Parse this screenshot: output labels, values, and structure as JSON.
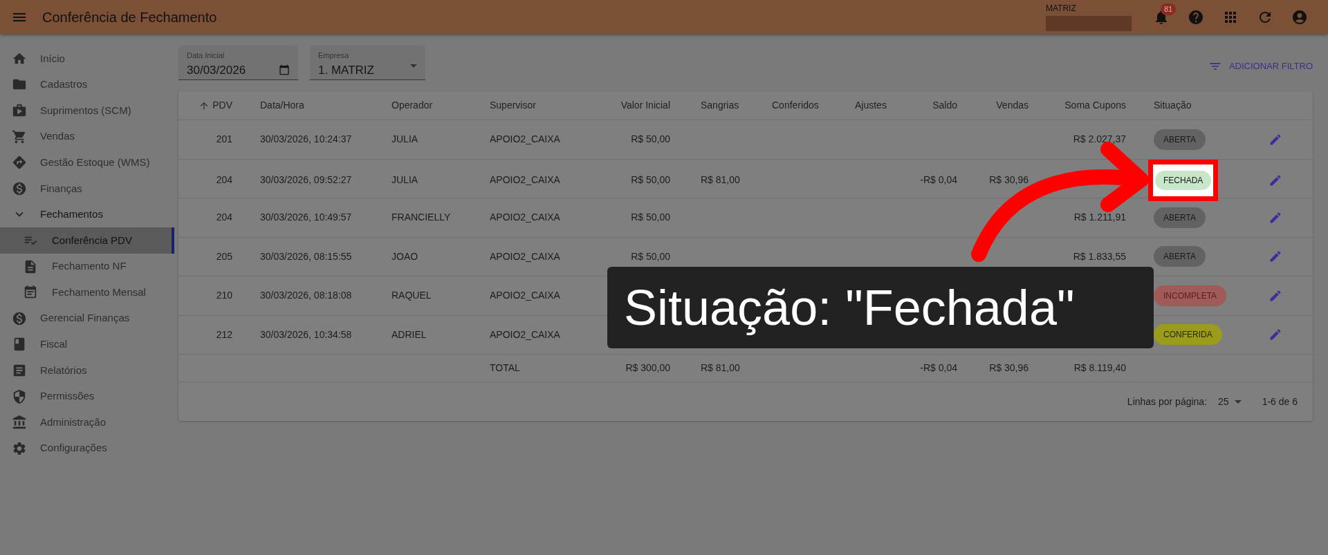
{
  "app_bar": {
    "title": "Conferência de Fechamento",
    "company": "MATRIZ",
    "notifications": "81"
  },
  "sidebar": {
    "items": [
      {
        "label": "Início",
        "selected": false
      },
      {
        "label": "Cadastros",
        "selected": false
      },
      {
        "label": "Suprimentos (SCM)",
        "selected": false
      },
      {
        "label": "Vendas",
        "selected": false
      },
      {
        "label": "Gestão Estoque (WMS)",
        "selected": false
      },
      {
        "label": "Finanças",
        "selected": false
      },
      {
        "label": "Fechamentos",
        "selected": false,
        "expanded": true,
        "children": [
          {
            "label": "Conferência PDV",
            "selected": true
          },
          {
            "label": "Fechamento NF",
            "selected": false
          },
          {
            "label": "Fechamento Mensal",
            "selected": false
          }
        ]
      },
      {
        "label": "Gerencial Finanças",
        "selected": false
      },
      {
        "label": "Fiscal",
        "selected": false
      },
      {
        "label": "Relatórios",
        "selected": false
      },
      {
        "label": "Permissões",
        "selected": false
      },
      {
        "label": "Administração",
        "selected": false
      },
      {
        "label": "Configurações",
        "selected": false
      }
    ]
  },
  "filters": {
    "date": {
      "label": "Data Inicial",
      "value": "30/03/2026"
    },
    "company": {
      "label": "Empresa",
      "value": "1. MATRIZ"
    },
    "add_filter": "ADICIONAR FILTRO"
  },
  "table": {
    "columns": [
      {
        "label": "PDV",
        "sorted": true
      },
      {
        "label": "Data/Hora",
        "sorted": false
      },
      {
        "label": "Operador",
        "sorted": false
      },
      {
        "label": "Supervisor",
        "sorted": false
      },
      {
        "label": "Valor Inicial",
        "sorted": false
      },
      {
        "label": "Sangrias",
        "sorted": false
      },
      {
        "label": "Conferidos",
        "sorted": false
      },
      {
        "label": "Ajustes",
        "sorted": false
      },
      {
        "label": "Saldo",
        "sorted": false
      },
      {
        "label": "Vendas",
        "sorted": false
      },
      {
        "label": "Soma Cupons",
        "sorted": false
      },
      {
        "label": "Situação",
        "sorted": false
      }
    ],
    "rows": [
      {
        "pdv": "201",
        "data_hora": "30/03/2026, 10:24:37",
        "operador": "JULIA",
        "supervisor": "APOIO2_CAIXA",
        "valor_inicial": "R$ 50,00",
        "soma_cupons": "R$ 2.027,37",
        "situacao": {
          "label": "ABERTA",
          "kind": "aberta"
        },
        "highlighted": false
      },
      {
        "pdv": "204",
        "data_hora": "30/03/2026, 09:52:27",
        "operador": "JULIA",
        "supervisor": "APOIO2_CAIXA",
        "valor_inicial": "R$ 50,00",
        "sangrias": "R$ 81,00",
        "saldo": "-R$ 0,04",
        "vendas": "R$ 30,96",
        "situacao": {
          "label": "FECHADA",
          "kind": "fechada"
        },
        "highlighted": true
      },
      {
        "pdv": "204",
        "data_hora": "30/03/2026, 10:49:57",
        "operador": "FRANCIELLY",
        "supervisor": "APOIO2_CAIXA",
        "valor_inicial": "R$ 50,00",
        "soma_cupons": "R$ 1.211,91",
        "situacao": {
          "label": "ABERTA",
          "kind": "aberta"
        },
        "highlighted": false
      },
      {
        "pdv": "205",
        "data_hora": "30/03/2026, 08:15:55",
        "operador": "JOAO",
        "supervisor": "APOIO2_CAIXA",
        "valor_inicial": "R$ 50,00",
        "soma_cupons": "R$ 1.833,55",
        "situacao": {
          "label": "ABERTA",
          "kind": "aberta"
        },
        "highlighted": false
      },
      {
        "pdv": "210",
        "data_hora": "30/03/2026, 08:18:08",
        "operador": "RAQUEL",
        "supervisor": "APOIO2_CAIXA",
        "situacao": {
          "label": "INCOMPLETA",
          "kind": "incompleta"
        },
        "highlighted": false
      },
      {
        "pdv": "212",
        "data_hora": "30/03/2026, 10:34:58",
        "operador": "ADRIEL",
        "supervisor": "APOIO2_CAIXA",
        "situacao": {
          "label": "CONFERIDA",
          "kind": "conferida"
        },
        "highlighted": false
      }
    ],
    "total": {
      "label": "TOTAL",
      "valor_inicial": "R$ 300,00",
      "sangrias": "R$ 81,00",
      "saldo": "-R$ 0,04",
      "vendas": "R$ 30,96",
      "soma_cupons": "R$ 8.119,40"
    },
    "pagination": {
      "rows_label": "Linhas por página:",
      "rows_value": "25",
      "range": "1-6 de 6"
    }
  },
  "callout": {
    "text": "Situação: \"Fechada\""
  }
}
